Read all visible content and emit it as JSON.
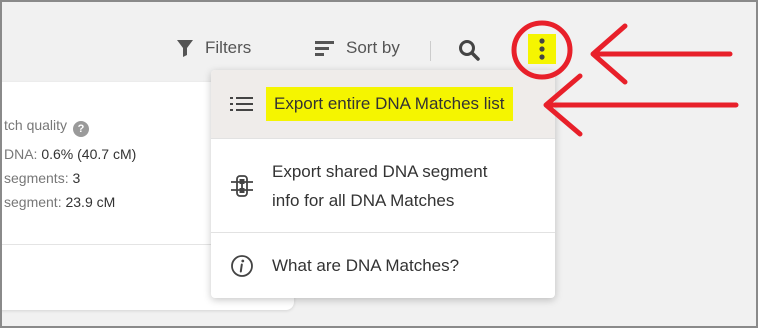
{
  "toolbar": {
    "filters_label": "Filters",
    "sort_label": "Sort by"
  },
  "card": {
    "match_quality_label": "tch quality",
    "help_glyph": "?",
    "shared_dna_key": "DNA:",
    "shared_dna_value": "0.6% (40.7 cM)",
    "segments_key": "segments:",
    "segments_value": "3",
    "largest_segment_key": "segment:",
    "largest_segment_value": "23.9 cM"
  },
  "menu": {
    "items": [
      {
        "label": "Export entire DNA Matches list",
        "icon": "list-icon"
      },
      {
        "label_line1": "Export shared DNA segment",
        "label_line2": "info for all DNA Matches",
        "icon": "dna-segment-icon"
      },
      {
        "label": "What are DNA Matches?",
        "icon": "info-icon"
      }
    ]
  },
  "colors": {
    "highlight": "#f5f500",
    "annotation_red": "#e8202a"
  }
}
